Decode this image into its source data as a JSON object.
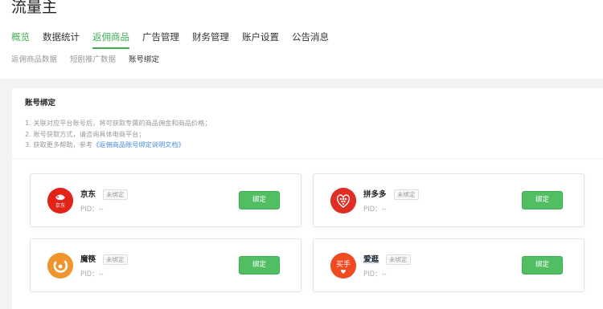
{
  "app": {
    "title": "流量主"
  },
  "nav": {
    "items": [
      {
        "label": "概览",
        "active": false
      },
      {
        "label": "数据统计",
        "active": false
      },
      {
        "label": "返佣商品",
        "active": true
      },
      {
        "label": "广告管理",
        "active": false
      },
      {
        "label": "财务管理",
        "active": false
      },
      {
        "label": "账户设置",
        "active": false
      },
      {
        "label": "公告消息",
        "active": false
      }
    ]
  },
  "sub_nav": {
    "items": [
      {
        "label": "返佣商品数据",
        "active": false
      },
      {
        "label": "短剧推广数据",
        "active": false
      },
      {
        "label": "账号绑定",
        "active": true
      }
    ]
  },
  "panel": {
    "title": "账号绑定",
    "tips": {
      "line1": "1. 关联对应平台账号后，将可获取专属的商品佣金和商品价格；",
      "line2": "2. 账号获取方式，请咨询具体电商平台；",
      "line3_prefix": "3. 获取更多帮助，参考",
      "line3_link": "《返佣商品账号绑定说明文档》"
    }
  },
  "platforms": [
    {
      "name": "京东",
      "status": "未绑定",
      "pid": "PID：--",
      "button": "绑定",
      "logo_text": "京东",
      "logo_color": "#e2231a",
      "icon": "jd-logo-icon"
    },
    {
      "name": "拼多多",
      "status": "未绑定",
      "pid": "PID：--",
      "button": "绑定",
      "logo_color": "#e02e24",
      "icon": "pinduoduo-logo-icon"
    },
    {
      "name": "魔筷",
      "status": "未绑定",
      "pid": "PID：--",
      "button": "绑定",
      "logo_color": "#f0952d",
      "icon": "mokuai-logo-icon"
    },
    {
      "name": "爱逛",
      "status": "未绑定",
      "pid": "PID：--",
      "button": "绑定",
      "logo_text": "买手",
      "logo_color": "#f04a23",
      "icon": "aiguang-logo-icon"
    }
  ],
  "colors": {
    "accent": "#3fae52",
    "button": "#52be63",
    "link": "#4a8fdc"
  }
}
